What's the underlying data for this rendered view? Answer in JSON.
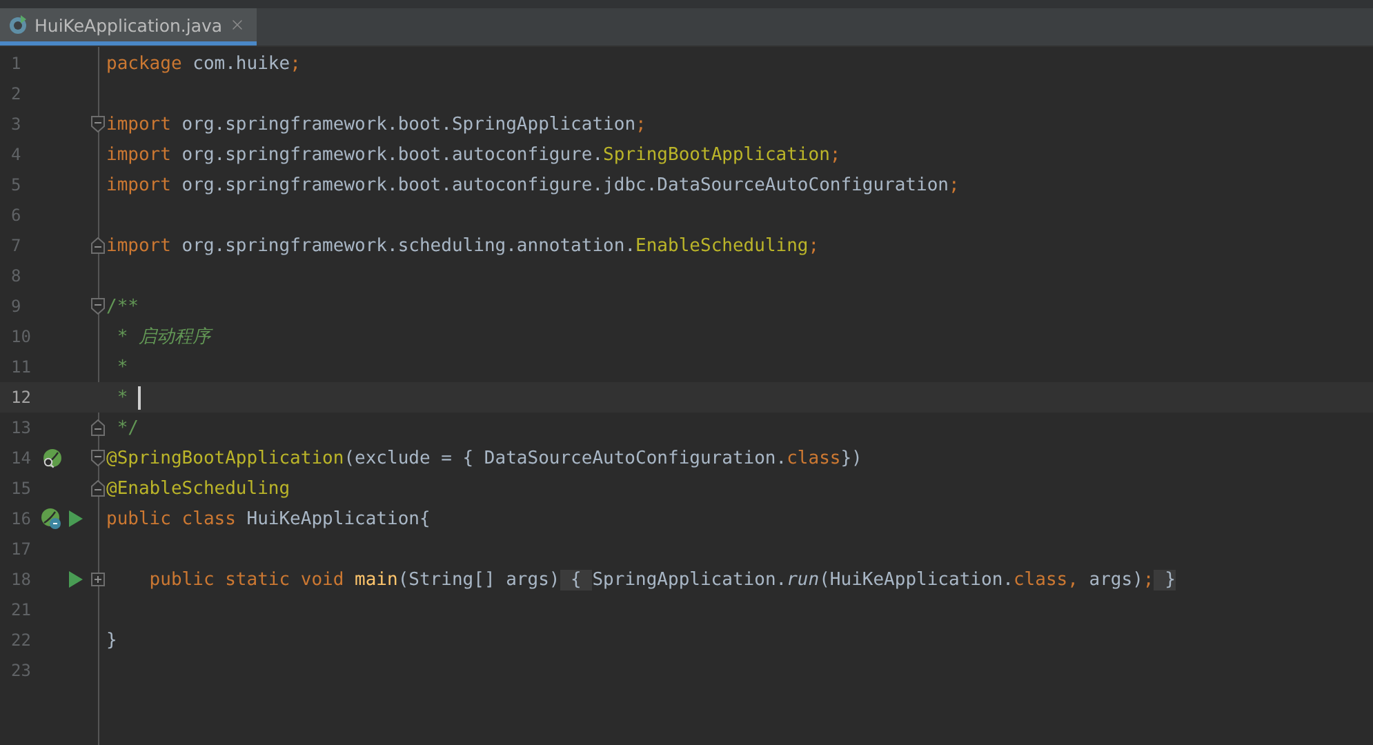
{
  "tabs": [
    {
      "label": "HuiKeApplication.java",
      "selected": true
    }
  ],
  "lines": [
    {
      "number": "1",
      "tokens": [
        {
          "text": "package ",
          "kind": "keyword"
        },
        {
          "text": "com.huike",
          "kind": "plain"
        },
        {
          "text": ";",
          "kind": "keyword"
        }
      ]
    },
    {
      "number": "2"
    },
    {
      "number": "3",
      "fold": {
        "kind": "start"
      },
      "tokens": [
        {
          "text": "import ",
          "kind": "keyword"
        },
        {
          "text": "org.springframework.boot.SpringApplication",
          "kind": "plain"
        },
        {
          "text": ";",
          "kind": "keyword"
        }
      ]
    },
    {
      "number": "4",
      "tokens": [
        {
          "text": "import ",
          "kind": "keyword"
        },
        {
          "text": "org.springframework.boot.autoconfigure.",
          "kind": "plain"
        },
        {
          "text": "SpringBootApplication",
          "kind": "annotation"
        },
        {
          "text": ";",
          "kind": "keyword"
        }
      ]
    },
    {
      "number": "5",
      "tokens": [
        {
          "text": "import ",
          "kind": "keyword"
        },
        {
          "text": "org.springframework.boot.autoconfigure.jdbc.DataSourceAutoConfiguration",
          "kind": "plain"
        },
        {
          "text": ";",
          "kind": "keyword"
        }
      ]
    },
    {
      "number": "6"
    },
    {
      "number": "7",
      "fold": {
        "kind": "end"
      },
      "tokens": [
        {
          "text": "import ",
          "kind": "keyword"
        },
        {
          "text": "org.springframework.scheduling.annotation.",
          "kind": "plain"
        },
        {
          "text": "EnableScheduling",
          "kind": "annotation"
        },
        {
          "text": ";",
          "kind": "keyword"
        }
      ]
    },
    {
      "number": "8"
    },
    {
      "number": "9",
      "fold": {
        "kind": "start"
      },
      "tokens": [
        {
          "text": "/**",
          "kind": "comment"
        }
      ]
    },
    {
      "number": "10",
      "tokens": [
        {
          "text": " * ",
          "kind": "comment"
        },
        {
          "text": "启动程序",
          "kind": "comment-italic"
        }
      ]
    },
    {
      "number": "11",
      "tokens": [
        {
          "text": " *",
          "kind": "comment"
        }
      ]
    },
    {
      "number": "12",
      "current": true,
      "caret": true,
      "tokens": [
        {
          "text": " * ",
          "kind": "comment"
        }
      ]
    },
    {
      "number": "13",
      "fold": {
        "kind": "end"
      },
      "tokens": [
        {
          "text": " */",
          "kind": "comment"
        }
      ]
    },
    {
      "number": "14",
      "fold": {
        "kind": "start"
      },
      "icons": [
        {
          "kind": "bean"
        }
      ],
      "tokens": [
        {
          "text": "@SpringBootApplication",
          "kind": "annotation"
        },
        {
          "text": "(exclude = { DataSourceAutoConfiguration.",
          "kind": "plain"
        },
        {
          "text": "class",
          "kind": "keyword"
        },
        {
          "text": "})",
          "kind": "plain"
        }
      ]
    },
    {
      "number": "15",
      "fold": {
        "kind": "end"
      },
      "tokens": [
        {
          "text": "@EnableScheduling",
          "kind": "annotation"
        }
      ]
    },
    {
      "number": "16",
      "icons": [
        {
          "kind": "boot"
        },
        {
          "kind": "run"
        }
      ],
      "tokens": [
        {
          "text": "public class ",
          "kind": "keyword"
        },
        {
          "text": "HuiKeApplication{",
          "kind": "plain"
        }
      ]
    },
    {
      "number": "17"
    },
    {
      "number": "18",
      "fold": {
        "kind": "collapsed"
      },
      "icons": [
        {
          "kind": "run"
        }
      ],
      "tokens": [
        {
          "text": "    public static void ",
          "kind": "keyword"
        },
        {
          "text": "main",
          "kind": "method"
        },
        {
          "text": "(String[] args)",
          "kind": "plain"
        },
        {
          "text": " { ",
          "kind": "folded"
        },
        {
          "text": "SpringApplication.",
          "kind": "plain"
        },
        {
          "text": "run",
          "kind": "static-call"
        },
        {
          "text": "(HuiKeApplication.",
          "kind": "plain"
        },
        {
          "text": "class, ",
          "kind": "keyword"
        },
        {
          "text": "args)",
          "kind": "plain"
        },
        {
          "text": ";",
          "kind": "keyword"
        },
        {
          "text": " }",
          "kind": "folded"
        }
      ]
    },
    {
      "number": "21"
    },
    {
      "number": "22",
      "tokens": [
        {
          "text": "}",
          "kind": "plain"
        }
      ]
    },
    {
      "number": "23"
    }
  ]
}
